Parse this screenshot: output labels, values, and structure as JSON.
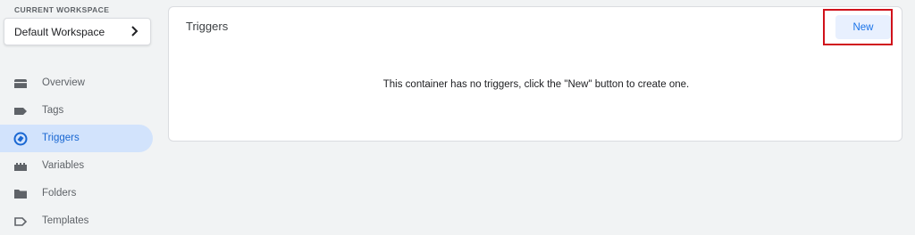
{
  "workspace": {
    "label": "CURRENT WORKSPACE",
    "name": "Default Workspace"
  },
  "nav": {
    "items": [
      {
        "label": "Overview",
        "icon": "overview-icon",
        "active": false
      },
      {
        "label": "Tags",
        "icon": "tag-icon",
        "active": false
      },
      {
        "label": "Triggers",
        "icon": "trigger-icon",
        "active": true
      },
      {
        "label": "Variables",
        "icon": "variables-icon",
        "active": false
      },
      {
        "label": "Folders",
        "icon": "folder-icon",
        "active": false
      },
      {
        "label": "Templates",
        "icon": "template-icon",
        "active": false
      }
    ]
  },
  "main": {
    "title": "Triggers",
    "new_label": "New",
    "empty_message": "This container has no triggers, click the \"New\" button to create one."
  },
  "colors": {
    "accent": "#1a73e8",
    "active_bg": "#d2e3fc",
    "highlight": "#d0121b",
    "icon_gray": "#5f6368"
  }
}
